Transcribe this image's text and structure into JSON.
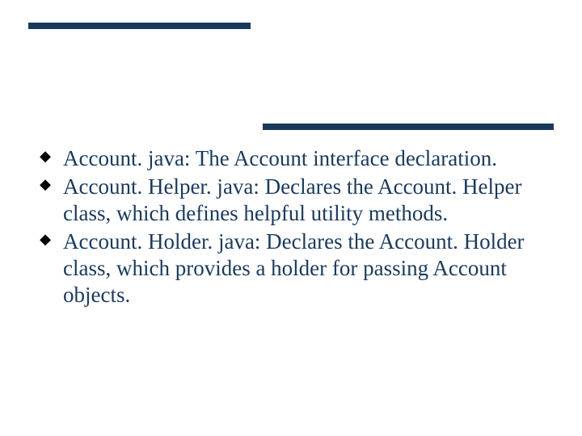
{
  "bullets": [
    {
      "text": "Account. java: The Account interface declaration."
    },
    {
      "text": "Account. Helper. java: Declares the Account. Helper class, which defines helpful utility methods."
    },
    {
      "text": "Account. Holder. java: Declares the Account. Holder class, which provides a holder for passing Account objects."
    }
  ]
}
